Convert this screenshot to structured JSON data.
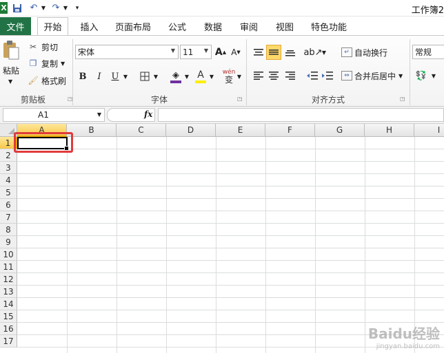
{
  "window": {
    "title": "工作簿2"
  },
  "tabs": [
    "文件",
    "开始",
    "插入",
    "页面布局",
    "公式",
    "数据",
    "审阅",
    "视图",
    "特色功能"
  ],
  "ribbon": {
    "clipboard": {
      "paste": "粘贴",
      "cut": "剪切",
      "copy": "复制",
      "format_painter": "格式刷",
      "label": "剪贴板"
    },
    "font": {
      "name": "宋体",
      "size": "11",
      "bold": "B",
      "italic": "I",
      "underline": "U",
      "label": "字体",
      "phonetic": "wén\n变"
    },
    "alignment": {
      "wrap_text": "自动换行",
      "merge_center": "合并后居中",
      "label": "对齐方式"
    },
    "number": {
      "format": "常规"
    }
  },
  "formula_bar": {
    "name_box": "A1",
    "fx": "fx",
    "value": ""
  },
  "sheet": {
    "columns": [
      "A",
      "B",
      "C",
      "D",
      "E",
      "F",
      "G",
      "H",
      "I"
    ],
    "rows": [
      "1",
      "2",
      "3",
      "4",
      "5",
      "6",
      "7",
      "8",
      "9",
      "10",
      "11",
      "12",
      "13",
      "14",
      "15",
      "16",
      "17"
    ],
    "active_cell": "A1"
  },
  "colors": {
    "file_tab": "#217346",
    "selected_header": "#f7c84c",
    "highlight": "#e03a3a"
  },
  "watermark": {
    "brand": "Baidu经验",
    "url": "jingyan.baidu.com"
  }
}
